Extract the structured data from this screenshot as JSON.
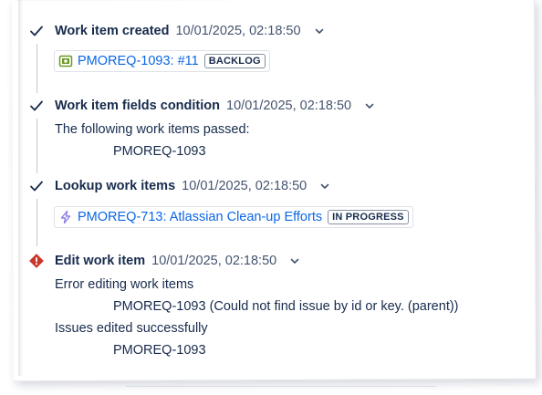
{
  "steps": [
    {
      "title": "Work item created",
      "timestamp": "10/01/2025, 02:18:50",
      "status": "success",
      "item": {
        "icon": "story-icon",
        "label": "PMOREQ-1093: #11",
        "status": "BACKLOG"
      }
    },
    {
      "title": "Work item fields condition",
      "timestamp": "10/01/2025, 02:18:50",
      "status": "success",
      "message": "The following work items passed:",
      "items": [
        "PMOREQ-1093"
      ]
    },
    {
      "title": "Lookup work items",
      "timestamp": "10/01/2025, 02:18:50",
      "status": "success",
      "item": {
        "icon": "epic-icon",
        "label": "PMOREQ-713: Atlassian Clean-up Efforts",
        "status": "IN PROGRESS"
      }
    },
    {
      "title": "Edit work item",
      "timestamp": "10/01/2025, 02:18:50",
      "status": "error",
      "error_message": "Error editing work items",
      "error_items": [
        "PMOREQ-1093 (Could not find issue by id or key. (parent))"
      ],
      "success_message": "Issues edited successfully",
      "success_items": [
        "PMOREQ-1093"
      ]
    }
  ],
  "colors": {
    "link": "#0c66e4",
    "error": "#c9372c",
    "story_icon": "#6a9a23",
    "epic_icon": "#8f7ee7"
  }
}
